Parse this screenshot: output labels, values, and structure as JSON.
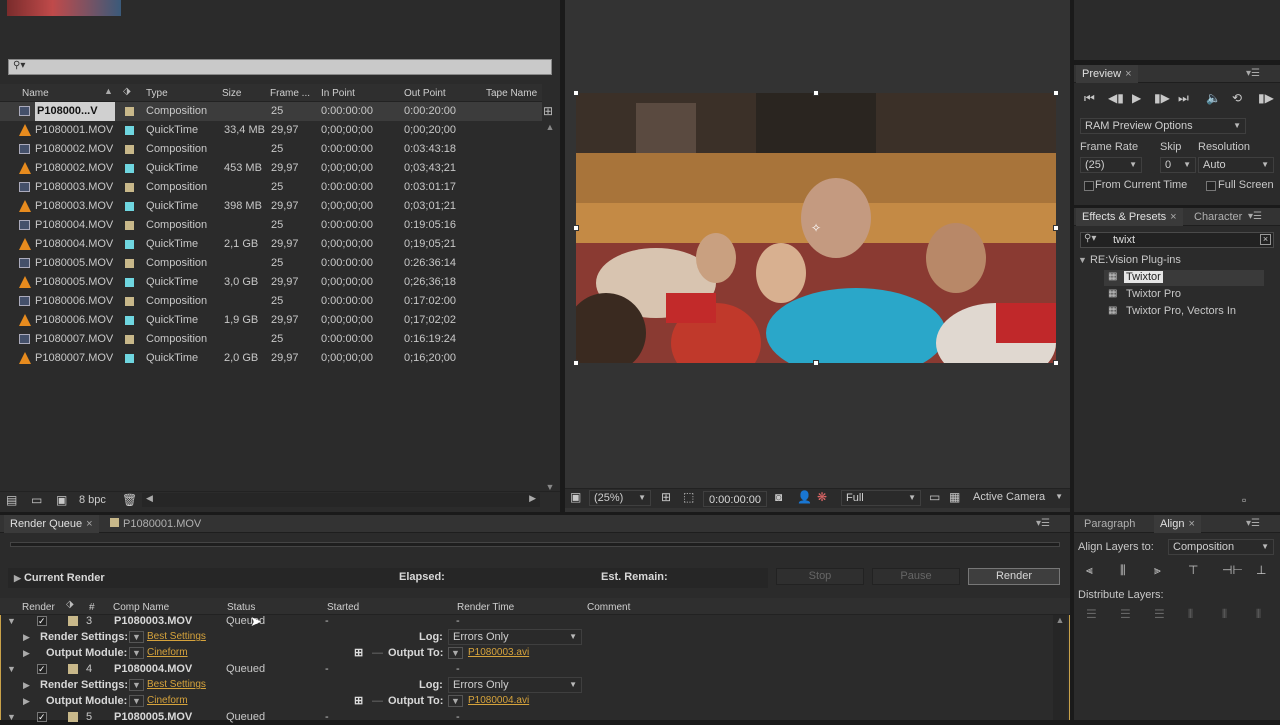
{
  "project": {
    "search_placeholder": "",
    "columns": [
      "Name",
      "Type",
      "Size",
      "Frame ...",
      "In Point",
      "Out Point",
      "Tape Name"
    ],
    "rows": [
      {
        "name": "P108000...V",
        "type": "Composition",
        "size": "",
        "frame": "25",
        "in": "0:00:00:00",
        "out": "0:00:20:00",
        "icon": "composition-icon",
        "color": "#c8b88a",
        "selected": true
      },
      {
        "name": "P1080001.MOV",
        "type": "QuickTime",
        "size": "33,4 MB",
        "frame": "29,97",
        "in": "0;00;00;00",
        "out": "0;00;20;00",
        "icon": "vlc-cone-icon",
        "color": "#6fd6e0"
      },
      {
        "name": "P1080002.MOV",
        "type": "Composition",
        "size": "",
        "frame": "25",
        "in": "0:00:00:00",
        "out": "0:03:43:18",
        "icon": "composition-icon",
        "color": "#c8b88a"
      },
      {
        "name": "P1080002.MOV",
        "type": "QuickTime",
        "size": "453 MB",
        "frame": "29,97",
        "in": "0;00;00;00",
        "out": "0;03;43;21",
        "icon": "vlc-cone-icon",
        "color": "#6fd6e0"
      },
      {
        "name": "P1080003.MOV",
        "type": "Composition",
        "size": "",
        "frame": "25",
        "in": "0:00:00:00",
        "out": "0:03:01:17",
        "icon": "composition-icon",
        "color": "#c8b88a"
      },
      {
        "name": "P1080003.MOV",
        "type": "QuickTime",
        "size": "398 MB",
        "frame": "29,97",
        "in": "0;00;00;00",
        "out": "0;03;01;21",
        "icon": "vlc-cone-icon",
        "color": "#6fd6e0"
      },
      {
        "name": "P1080004.MOV",
        "type": "Composition",
        "size": "",
        "frame": "25",
        "in": "0:00:00:00",
        "out": "0:19:05:16",
        "icon": "composition-icon",
        "color": "#c8b88a"
      },
      {
        "name": "P1080004.MOV",
        "type": "QuickTime",
        "size": "2,1 GB",
        "frame": "29,97",
        "in": "0;00;00;00",
        "out": "0;19;05;21",
        "icon": "vlc-cone-icon",
        "color": "#6fd6e0"
      },
      {
        "name": "P1080005.MOV",
        "type": "Composition",
        "size": "",
        "frame": "25",
        "in": "0:00:00:00",
        "out": "0:26:36:14",
        "icon": "composition-icon",
        "color": "#c8b88a"
      },
      {
        "name": "P1080005.MOV",
        "type": "QuickTime",
        "size": "3,0 GB",
        "frame": "29,97",
        "in": "0;00;00;00",
        "out": "0;26;36;18",
        "icon": "vlc-cone-icon",
        "color": "#6fd6e0"
      },
      {
        "name": "P1080006.MOV",
        "type": "Composition",
        "size": "",
        "frame": "25",
        "in": "0:00:00:00",
        "out": "0:17:02:00",
        "icon": "composition-icon",
        "color": "#c8b88a"
      },
      {
        "name": "P1080006.MOV",
        "type": "QuickTime",
        "size": "1,9 GB",
        "frame": "29,97",
        "in": "0;00;00;00",
        "out": "0;17;02;02",
        "icon": "vlc-cone-icon",
        "color": "#6fd6e0"
      },
      {
        "name": "P1080007.MOV",
        "type": "Composition",
        "size": "",
        "frame": "25",
        "in": "0:00:00:00",
        "out": "0:16:19:24",
        "icon": "composition-icon",
        "color": "#c8b88a"
      },
      {
        "name": "P1080007.MOV",
        "type": "QuickTime",
        "size": "2,0 GB",
        "frame": "29,97",
        "in": "0;00;00;00",
        "out": "0;16;20;00",
        "icon": "vlc-cone-icon",
        "color": "#6fd6e0"
      }
    ],
    "bpc_label": "8 bpc"
  },
  "viewer": {
    "zoom": "(25%)",
    "timecode": "0:00:00:00",
    "resolution": "Full",
    "camera": "Active Camera"
  },
  "preview": {
    "tab": "Preview",
    "ram_options": "RAM Preview Options",
    "frame_rate_label": "Frame Rate",
    "skip_label": "Skip",
    "resolution_label": "Resolution",
    "frame_rate_value": "(25)",
    "skip_value": "0",
    "resolution_value": "Auto",
    "from_current": "From Current Time",
    "full_screen": "Full Screen"
  },
  "effects": {
    "tab": "Effects & Presets",
    "tab2": "Character",
    "search": "twixt",
    "group": "RE:Vision Plug-ins",
    "items": [
      "Twixtor",
      "Twixtor Pro",
      "Twixtor Pro, Vectors In"
    ]
  },
  "align": {
    "tab1": "Paragraph",
    "tab2": "Align",
    "align_layers_to": "Align Layers to:",
    "align_target": "Composition",
    "distribute": "Distribute Layers:"
  },
  "render_queue": {
    "tab1": "Render Queue",
    "tab2": "P1080001.MOV",
    "current_render": "Current Render",
    "elapsed": "Elapsed:",
    "est_remain": "Est. Remain:",
    "stop": "Stop",
    "pause": "Pause",
    "render": "Render",
    "columns": [
      "Render",
      "#",
      "Comp Name",
      "Status",
      "Started",
      "Render Time",
      "Comment"
    ],
    "render_settings_label": "Render Settings:",
    "output_module_label": "Output Module:",
    "log_label": "Log:",
    "output_to_label": "Output To:",
    "items": [
      {
        "num": "3",
        "comp": "P1080003.MOV",
        "status": "Queued",
        "started": "-",
        "render_time": "-",
        "settings": "Best Settings",
        "module": "Cineform",
        "log": "Errors Only",
        "output": "P1080003.avi"
      },
      {
        "num": "4",
        "comp": "P1080004.MOV",
        "status": "Queued",
        "started": "-",
        "render_time": "-",
        "settings": "Best Settings",
        "module": "Cineform",
        "log": "Errors Only",
        "output": "P1080004.avi"
      },
      {
        "num": "5",
        "comp": "P1080005.MOV",
        "status": "Queued",
        "started": "-",
        "render_time": "-"
      }
    ]
  }
}
